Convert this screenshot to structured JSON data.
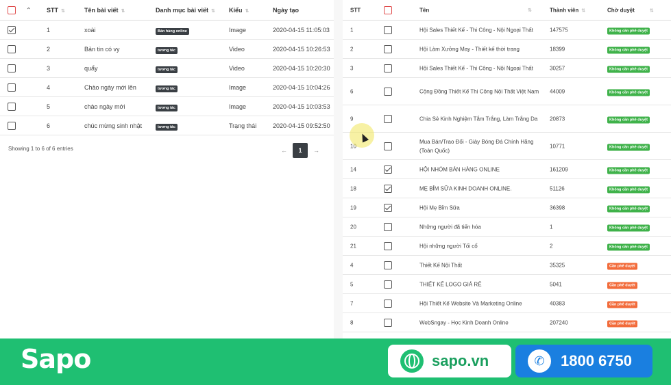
{
  "left_table": {
    "headers": {
      "stt": "STT",
      "title": "Tên bài viết",
      "category": "Danh mục bài viết",
      "type": "Kiểu",
      "date": "Ngày tạo"
    },
    "rows": [
      {
        "checked": true,
        "stt": "1",
        "title": "xoài",
        "category": "Bán hàng online",
        "type": "Image",
        "date": "2020-04-15 11:05:03"
      },
      {
        "checked": false,
        "stt": "2",
        "title": "Bản tin có vy",
        "category": "tương tác",
        "type": "Video",
        "date": "2020-04-15 10:26:53"
      },
      {
        "checked": false,
        "stt": "3",
        "title": "quẩy",
        "category": "tương tác",
        "type": "Video",
        "date": "2020-04-15 10:20:30"
      },
      {
        "checked": false,
        "stt": "4",
        "title": "Chào ngày mới lên",
        "category": "tương tác",
        "type": "Image",
        "date": "2020-04-15 10:04:26"
      },
      {
        "checked": false,
        "stt": "5",
        "title": "chào ngày mới",
        "category": "tương tác",
        "type": "Image",
        "date": "2020-04-15 10:03:53"
      },
      {
        "checked": false,
        "stt": "6",
        "title": "chúc mừng sinh nhật",
        "category": "tương tác",
        "type": "Trạng thái",
        "date": "2020-04-15 09:52:50"
      }
    ],
    "footer": "Showing 1 to 6 of 6 entries",
    "pager": {
      "prev": "←",
      "page": "1",
      "next": "→"
    }
  },
  "right_table": {
    "headers": {
      "stt": "STT",
      "name": "Tên",
      "members": "Thành viên",
      "approval": "Chờ duyệt"
    },
    "rows": [
      {
        "stt": "1",
        "checked": false,
        "name": "Hội Sales Thiết Kế - Thi Công - Nội Ngoại Thất",
        "members": "147575",
        "status": "Không cần phê duyệt",
        "color": "green",
        "h": 28
      },
      {
        "stt": "2",
        "checked": false,
        "name": "Hội Làm Xưởng May - Thiết kế thời trang",
        "members": "18399",
        "status": "Không cần phê duyệt",
        "color": "green",
        "h": 28
      },
      {
        "stt": "3",
        "checked": false,
        "name": "Hội Sales Thiết Kế - Thi Công - Nội Ngoại Thất",
        "members": "30257",
        "status": "Không cần phê duyệt",
        "color": "green",
        "h": 28
      },
      {
        "stt": "6",
        "checked": false,
        "name": "Cộng Đồng Thiết Kế Thi Công Nội Thất Việt Nam",
        "members": "44009",
        "status": "Không cần phê duyệt",
        "color": "green",
        "h": 40
      },
      {
        "stt": "9",
        "checked": false,
        "name": "Chia Sẻ Kinh Nghiệm Tắm Trắng, Làm Trắng Da",
        "members": "20873",
        "status": "Không cần phê duyệt",
        "color": "green",
        "h": 40
      },
      {
        "stt": "10",
        "checked": false,
        "name": "Mua Bán/Trao Đổi - Giày Bóng Đá Chính Hãng (Toàn Quốc)",
        "members": "10771",
        "status": "Không cần phê duyệt",
        "color": "green",
        "h": 40
      },
      {
        "stt": "14",
        "checked": true,
        "name": "HỘI NHÓM BÁN HÀNG ONLINE",
        "members": "161209",
        "status": "Không cần phê duyệt",
        "color": "green",
        "h": 28
      },
      {
        "stt": "18",
        "checked": true,
        "name": "MẸ BỈM SỮA KINH DOANH ONLINE.",
        "members": "51126",
        "status": "Không cần phê duyệt",
        "color": "green",
        "h": 28
      },
      {
        "stt": "19",
        "checked": true,
        "name": "Hội Mẹ Bỉm Sữa",
        "members": "36398",
        "status": "Không cần phê duyệt",
        "color": "green",
        "h": 28
      },
      {
        "stt": "20",
        "checked": false,
        "name": "Những người đã tiến hóa",
        "members": "1",
        "status": "Không cần phê duyệt",
        "color": "green",
        "h": 28
      },
      {
        "stt": "21",
        "checked": false,
        "name": "Hội những người Tối cổ",
        "members": "2",
        "status": "Không cần phê duyệt",
        "color": "green",
        "h": 28
      },
      {
        "stt": "4",
        "checked": false,
        "name": "Thiết Kế Nội Thất",
        "members": "35325",
        "status": "Cần phê duyệt",
        "color": "orange",
        "h": 28
      },
      {
        "stt": "5",
        "checked": false,
        "name": "THIẾT KẾ LOGO GIÁ RẺ",
        "members": "5041",
        "status": "Cần phê duyệt",
        "color": "orange",
        "h": 28
      },
      {
        "stt": "7",
        "checked": false,
        "name": "Hội Thiết Kế Website Và Marketing Online",
        "members": "40383",
        "status": "Cần phê duyệt",
        "color": "orange",
        "h": 28
      },
      {
        "stt": "8",
        "checked": false,
        "name": "WebSngay - Học Kinh Doanh Online",
        "members": "207240",
        "status": "Cần phê duyệt",
        "color": "orange",
        "h": 28
      }
    ]
  },
  "banner": {
    "logo": "Sapo",
    "website": "sapo.vn",
    "hotline": "1800 6750",
    "colors": {
      "green": "#1fbf72",
      "blue": "#1a7fe0"
    },
    "icons": {
      "site": "globe-icon",
      "hotline": "phone-icon"
    }
  }
}
